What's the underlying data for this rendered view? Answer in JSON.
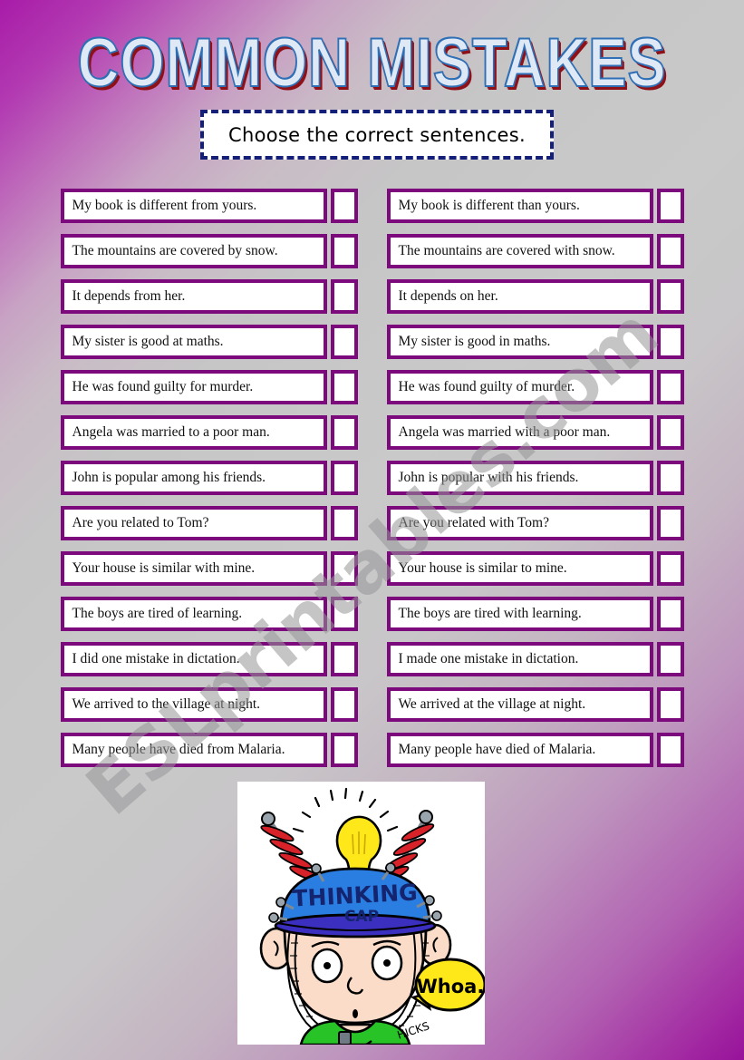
{
  "title": "COMMON MISTAKES",
  "instruction": "Choose the correct sentences.",
  "columns": {
    "left": [
      "My book is different from yours.",
      "The mountains are covered by snow.",
      "It depends from her.",
      "My sister is good at maths.",
      "He was found guilty for murder.",
      "Angela was married to a poor man.",
      "John is popular among his friends.",
      "Are you related to Tom?",
      "Your house is similar with mine.",
      "The boys are tired of learning.",
      "I did one mistake in dictation.",
      "We arrived to the village at night.",
      "Many people have died from Malaria."
    ],
    "right": [
      "My book is different than yours.",
      "The mountains are covered with snow.",
      "It depends on her.",
      "My sister is good in maths.",
      "He was found guilty of murder.",
      "Angela was married with a poor man.",
      "John is popular with his friends.",
      "Are you related with Tom?",
      "Your house is similar to mine.",
      "The boys are tired with learning.",
      "I made one mistake in dictation.",
      "We arrived at the village at night.",
      "Many people have died of Malaria."
    ]
  },
  "watermark": "ESLprintables.com",
  "illustration": {
    "cap_text_line1": "THINKING",
    "cap_text_line2": "CAP",
    "speech_bubble": "Whoa.",
    "signature": "HICKS"
  },
  "colors": {
    "box_border": "#7d0a7d",
    "instruction_border": "#141f7a",
    "title_fill": "#dfe8f5",
    "title_stroke": "#2f6fb5",
    "title_shadow": "#8e1118",
    "cap_blue": "#2a7de1",
    "bulb_yellow": "#ffe81a",
    "shirt_green": "#27c327",
    "skin": "#fadcc8"
  }
}
